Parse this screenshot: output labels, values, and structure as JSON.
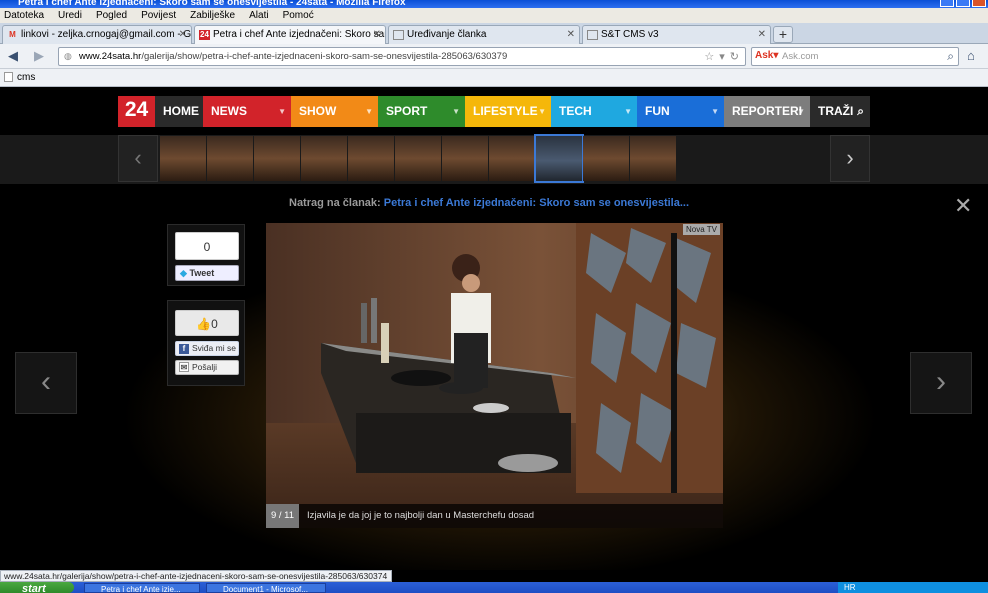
{
  "window": {
    "title": "Petra i chef Ante izjednačeni: Skoro sam se onesvijestila - 24sata - Mozilla Firefox"
  },
  "menu": [
    "Datoteka",
    "Uredi",
    "Pogled",
    "Povijest",
    "Zabilješke",
    "Alati",
    "Pomoć"
  ],
  "tabs": [
    {
      "label": "linkovi - zeljka.crnogaj@gmail.com - Gmail",
      "fav": "M"
    },
    {
      "label": "Petra i chef Ante izjednačeni: Skoro sam ...",
      "fav": "24"
    },
    {
      "label": "Uređivanje članka",
      "fav": ""
    },
    {
      "label": "S&T CMS v3",
      "fav": ""
    }
  ],
  "url": {
    "host": "www.24sata.hr",
    "path": "/galerija/show/petra-i-chef-ante-izjednaceni-skoro-sam-se-onesvijestila-285063/630379"
  },
  "search": {
    "placeholder": "Ask.com",
    "engine": "ask"
  },
  "bookmarks": [
    "cms"
  ],
  "site": {
    "logo": "24",
    "nav": [
      {
        "label": "HOME",
        "color": "#2a2a2a",
        "dd": false
      },
      {
        "label": "NEWS",
        "color": "#d2232a",
        "dd": true
      },
      {
        "label": "SHOW",
        "color": "#f28a17",
        "dd": true
      },
      {
        "label": "SPORT",
        "color": "#2e8b2b",
        "dd": true
      },
      {
        "label": "LIFESTYLE",
        "color": "#f5b70a",
        "dd": true
      },
      {
        "label": "TECH",
        "color": "#1fa8e0",
        "dd": true
      },
      {
        "label": "FUN",
        "color": "#1a6ed8",
        "dd": true
      },
      {
        "label": "REPORTERI",
        "color": "#7d7d7d",
        "dd": true
      },
      {
        "label": "TRAŽI",
        "color": "#2a2a2a",
        "dd": false
      }
    ]
  },
  "gallery": {
    "back_prefix": "Natrag na članak: ",
    "back_link": "Petra i chef Ante izjednačeni: Skoro sam se onesvijestila...",
    "counter": "9 / 11",
    "caption": "Izjavila je da joj je to najbolji dan u Masterchefu dosad",
    "credit": "Nova TV",
    "thumb_count": 11,
    "selected_thumb": 8
  },
  "social": {
    "tweet_count": "0",
    "tweet_label": "Tweet",
    "like_count": "0",
    "like_label": "Sviđa mi se",
    "send_label": "Pošalji"
  },
  "status": "www.24sata.hr/galerija/show/petra-i-chef-ante-izjednaceni-skoro-sam-se-onesvijestila-285063/630374",
  "taskbar": {
    "start": "start",
    "items": [
      "Petra i chef Ante izje...",
      "Document1 - Microsof..."
    ],
    "tray": "HR"
  }
}
